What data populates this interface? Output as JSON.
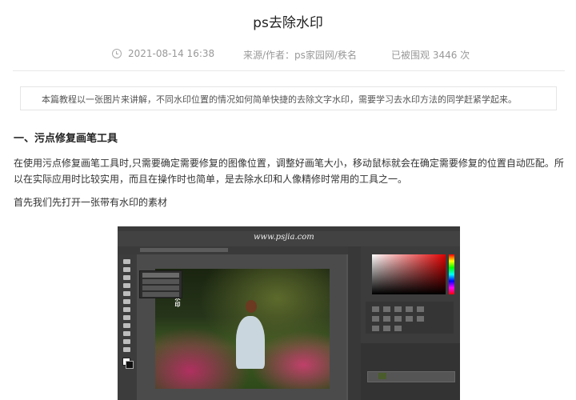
{
  "article": {
    "title": "ps去除水印",
    "date": "2021-08-14 16:38",
    "source": "来源/作者：ps家园网/秩名",
    "views": "已被围观 3446 次",
    "summary": "本篇教程以一张图片来讲解，不同水印位置的情况如何简单快捷的去除文字水印，需要学习去水印方法的同学赶紧学起来。",
    "section_heading": "一、污点修复画笔工具",
    "paragraph1": "在使用污点修复画笔工具时,只需要确定需要修复的图像位置，调整好画笔大小，移动鼠标就会在确定需要修复的位置自动匹配。所以在实际应用时比较实用，而且在操作时也简单，是去除水印和人像精修时常用的工具之一。",
    "paragraph2": "首先我们先打开一张带有水印的素材"
  },
  "screenshot": {
    "site_watermark": "www.psjia.com",
    "photo_watermark": "水印"
  },
  "icons": {
    "date": "clock-icon"
  }
}
